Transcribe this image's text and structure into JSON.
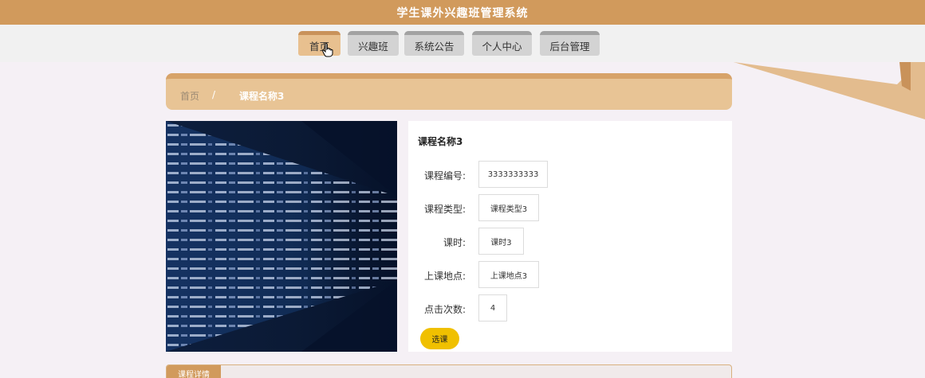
{
  "header": {
    "title": "学生课外兴趣班管理系统"
  },
  "nav": {
    "items": [
      {
        "label": "首页",
        "active": true
      },
      {
        "label": "兴趣班"
      },
      {
        "label": "系统公告"
      },
      {
        "label": "个人中心"
      },
      {
        "label": "后台管理"
      }
    ]
  },
  "breadcrumb": {
    "home": "首页",
    "separator": "/",
    "current": "课程名称3"
  },
  "course": {
    "name": "课程名称3",
    "fields": [
      {
        "label": "课程编号:",
        "value": "3333333333"
      },
      {
        "label": "课程类型:",
        "value": "课程类型3"
      },
      {
        "label": "课时:",
        "value": "课时3"
      },
      {
        "label": "上课地点:",
        "value": "上课地点3"
      },
      {
        "label": "点击次数:",
        "value": "4"
      }
    ],
    "enroll_button": "选课"
  },
  "details": {
    "tab_label": "课程详情"
  },
  "colors": {
    "primary": "#d19a5c",
    "accent": "#f0c000",
    "background": "#f5f0f5"
  }
}
